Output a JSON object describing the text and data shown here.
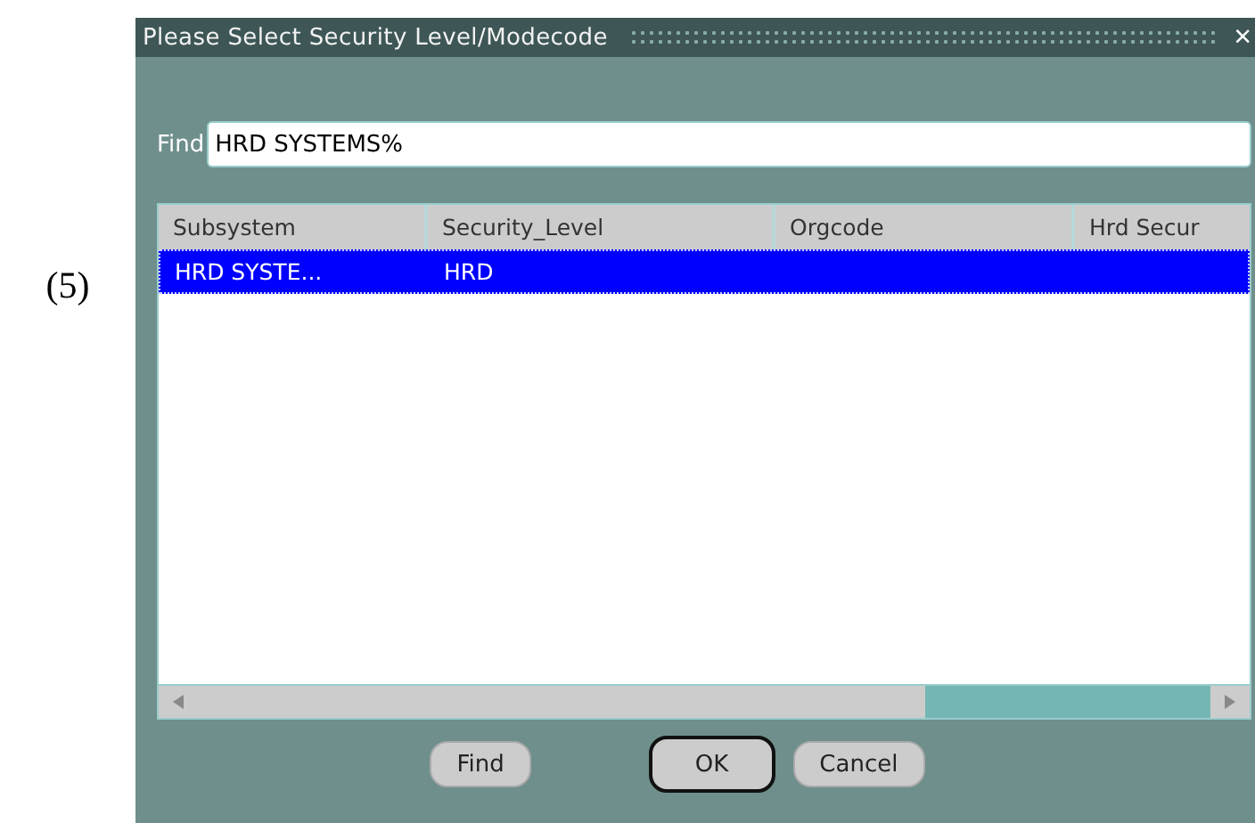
{
  "figure_label": "(5)",
  "window": {
    "title": "Please Select Security Level/Modecode",
    "close": "×"
  },
  "find": {
    "label": "Find",
    "value": "HRD SYSTEMS%"
  },
  "table": {
    "columns": [
      "Subsystem",
      "Security_Level",
      "Orgcode",
      "Hrd Secur"
    ],
    "rows": [
      {
        "cells": [
          "HRD SYSTE...",
          "HRD",
          "",
          ""
        ],
        "selected": true
      }
    ]
  },
  "buttons": [
    {
      "label": "Find",
      "default": false
    },
    {
      "label": "OK",
      "default": true
    },
    {
      "label": "Cancel",
      "default": false
    }
  ]
}
